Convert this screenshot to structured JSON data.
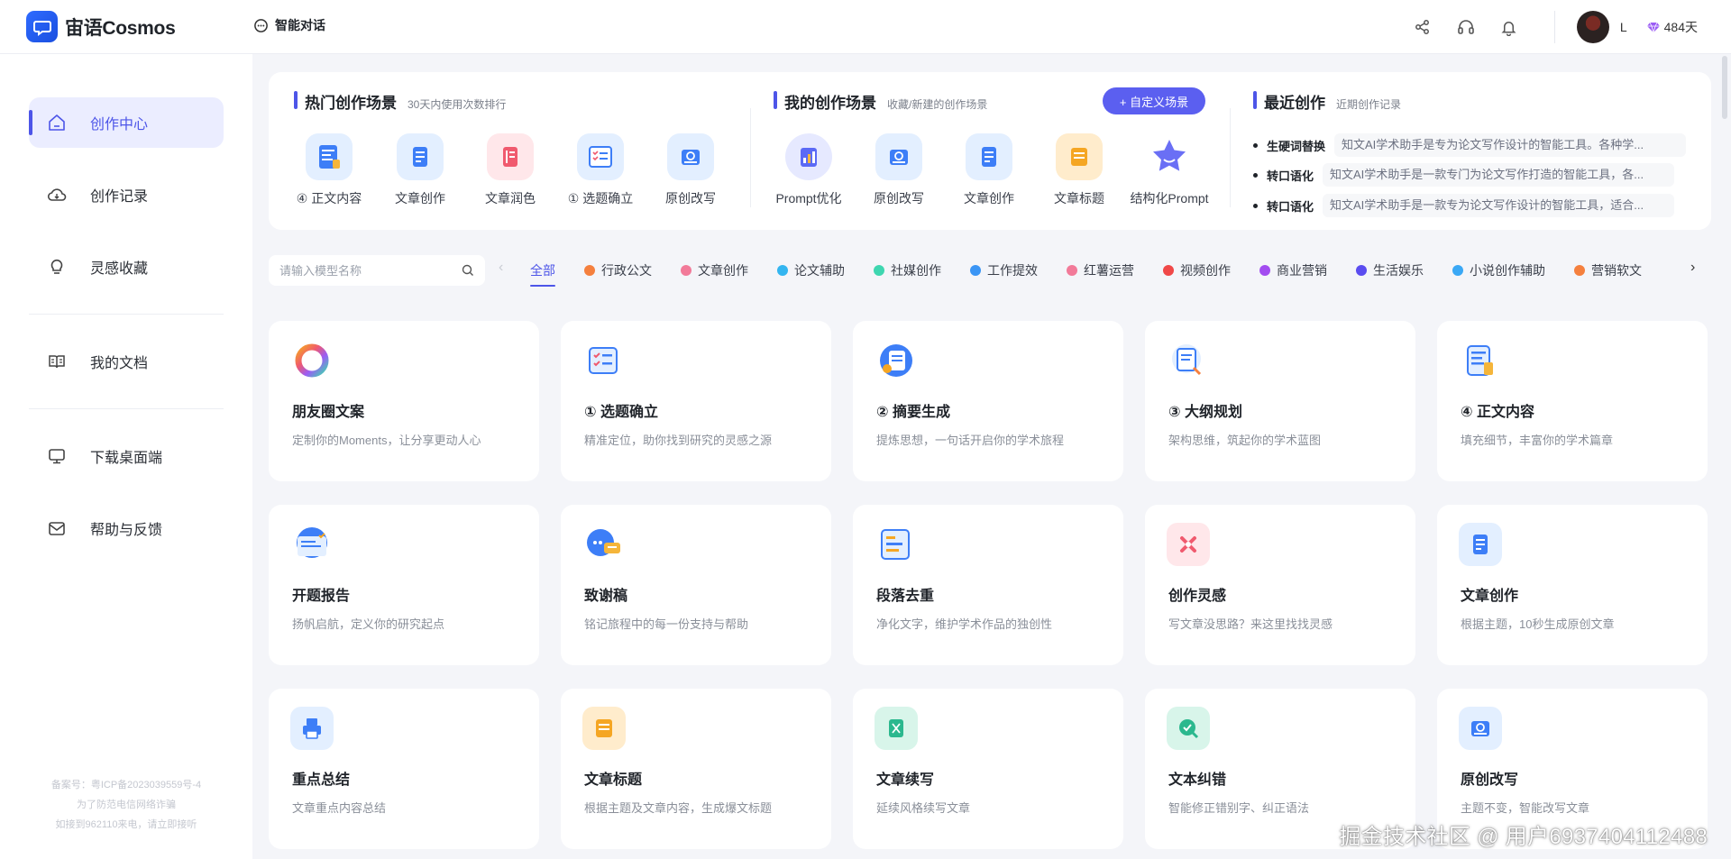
{
  "app": {
    "name": "宙语Cosmos",
    "chat_link": "智能对话"
  },
  "user": {
    "name": "L",
    "days": "484天"
  },
  "colors": {
    "accent": "#4d55e8",
    "button": "#5b5ff0"
  },
  "sidebar": {
    "items": [
      {
        "label": "创作中心",
        "icon": "home-icon",
        "active": true
      },
      {
        "label": "创作记录",
        "icon": "cloud-icon"
      },
      {
        "label": "灵感收藏",
        "icon": "lightbulb-icon"
      },
      {
        "label": "我的文档",
        "icon": "book-icon"
      },
      {
        "label": "下载桌面端",
        "icon": "monitor-icon"
      },
      {
        "label": "帮助与反馈",
        "icon": "mail-icon"
      }
    ],
    "icp": [
      "备案号：粤ICP备2023039559号-4",
      "为了防范电信网络诈骗",
      "如接到962110来电，请立即接听"
    ]
  },
  "hot": {
    "title": "热门创作场景",
    "subtitle": "30天内使用次数排行",
    "items": [
      {
        "label": "④ 正文内容",
        "icon": "document-icon"
      },
      {
        "label": "文章创作",
        "icon": "article-icon"
      },
      {
        "label": "文章润色",
        "icon": "polish-icon"
      },
      {
        "label": "① 选题确立",
        "icon": "checklist-icon"
      },
      {
        "label": "原创改写",
        "icon": "rewrite-icon"
      }
    ]
  },
  "mine": {
    "title": "我的创作场景",
    "subtitle": "收藏/新建的创作场景",
    "button": "+ 自定义场景",
    "items": [
      {
        "label": "Prompt优化",
        "icon": "chart-icon"
      },
      {
        "label": "原创改写",
        "icon": "rewrite-icon"
      },
      {
        "label": "文章创作",
        "icon": "article-icon"
      },
      {
        "label": "文章标题",
        "icon": "title-icon"
      },
      {
        "label": "结构化Prompt",
        "icon": "star-icon"
      }
    ]
  },
  "recent": {
    "title": "最近创作",
    "subtitle": "近期创作记录",
    "items": [
      {
        "name": "生硬词替换",
        "desc": "知文AI学术助手是专为论文写作设计的智能工具。各种学..."
      },
      {
        "name": "转口语化",
        "desc": "知文AI学术助手是一款专门为论文写作打造的智能工具，各..."
      },
      {
        "name": "转口语化",
        "desc": "知文AI学术助手是一款专为论文写作设计的智能工具，适合..."
      }
    ]
  },
  "search": {
    "placeholder": "请输入模型名称"
  },
  "categories": [
    {
      "label": "全部",
      "active": true
    },
    {
      "label": "行政公文",
      "color": "#f5803e"
    },
    {
      "label": "文章创作",
      "color": "#f27a99"
    },
    {
      "label": "论文辅助",
      "color": "#33b5f0"
    },
    {
      "label": "社媒创作",
      "color": "#3ed6b0"
    },
    {
      "label": "工作提效",
      "color": "#3a95f5"
    },
    {
      "label": "红薯运营",
      "color": "#f27a99"
    },
    {
      "label": "视频创作",
      "color": "#f04848"
    },
    {
      "label": "商业营销",
      "color": "#a24cf0"
    },
    {
      "label": "生活娱乐",
      "color": "#5a4cf0"
    },
    {
      "label": "小说创作辅助",
      "color": "#3aa8f5"
    },
    {
      "label": "营销软文",
      "color": "#f5803e"
    }
  ],
  "cards": [
    {
      "title": "朋友圈文案",
      "desc": "定制你的Moments，让分享更动人心",
      "icon": "ring-icon"
    },
    {
      "title": "① 选题确立",
      "desc": "精准定位，助你找到研究的灵感之源",
      "icon": "checklist-icon"
    },
    {
      "title": "② 摘要生成",
      "desc": "提炼思想，一句话开启你的学术旅程",
      "icon": "summary-icon"
    },
    {
      "title": "③ 大纲规划",
      "desc": "架构思维，筑起你的学术蓝图",
      "icon": "outline-icon"
    },
    {
      "title": "④ 正文内容",
      "desc": "填充细节，丰富你的学术篇章",
      "icon": "document-icon"
    },
    {
      "title": "开题报告",
      "desc": "扬帆启航，定义你的研究起点",
      "icon": "report-icon"
    },
    {
      "title": "致谢稿",
      "desc": "铭记旅程中的每一份支持与帮助",
      "icon": "chat-bubble-icon"
    },
    {
      "title": "段落去重",
      "desc": "净化文字，维护学术作品的独创性",
      "icon": "dedupe-icon"
    },
    {
      "title": "创作灵感",
      "desc": "写文章没思路？来这里找找灵感",
      "icon": "sparkle-icon"
    },
    {
      "title": "文章创作",
      "desc": "根据主题，10秒生成原创文章",
      "icon": "article-icon"
    },
    {
      "title": "重点总结",
      "desc": "文章重点内容总结",
      "icon": "printer-icon"
    },
    {
      "title": "文章标题",
      "desc": "根据主题及文章内容，生成爆文标题",
      "icon": "title-icon"
    },
    {
      "title": "文章续写",
      "desc": "延续风格续写文章",
      "icon": "continue-icon"
    },
    {
      "title": "文本纠错",
      "desc": "智能修正错别字、纠正语法",
      "icon": "check-icon"
    },
    {
      "title": "原创改写",
      "desc": "主题不变，智能改写文章",
      "icon": "rewrite-icon"
    }
  ],
  "watermark": "掘金技术社区 @ 用户6937404112488"
}
